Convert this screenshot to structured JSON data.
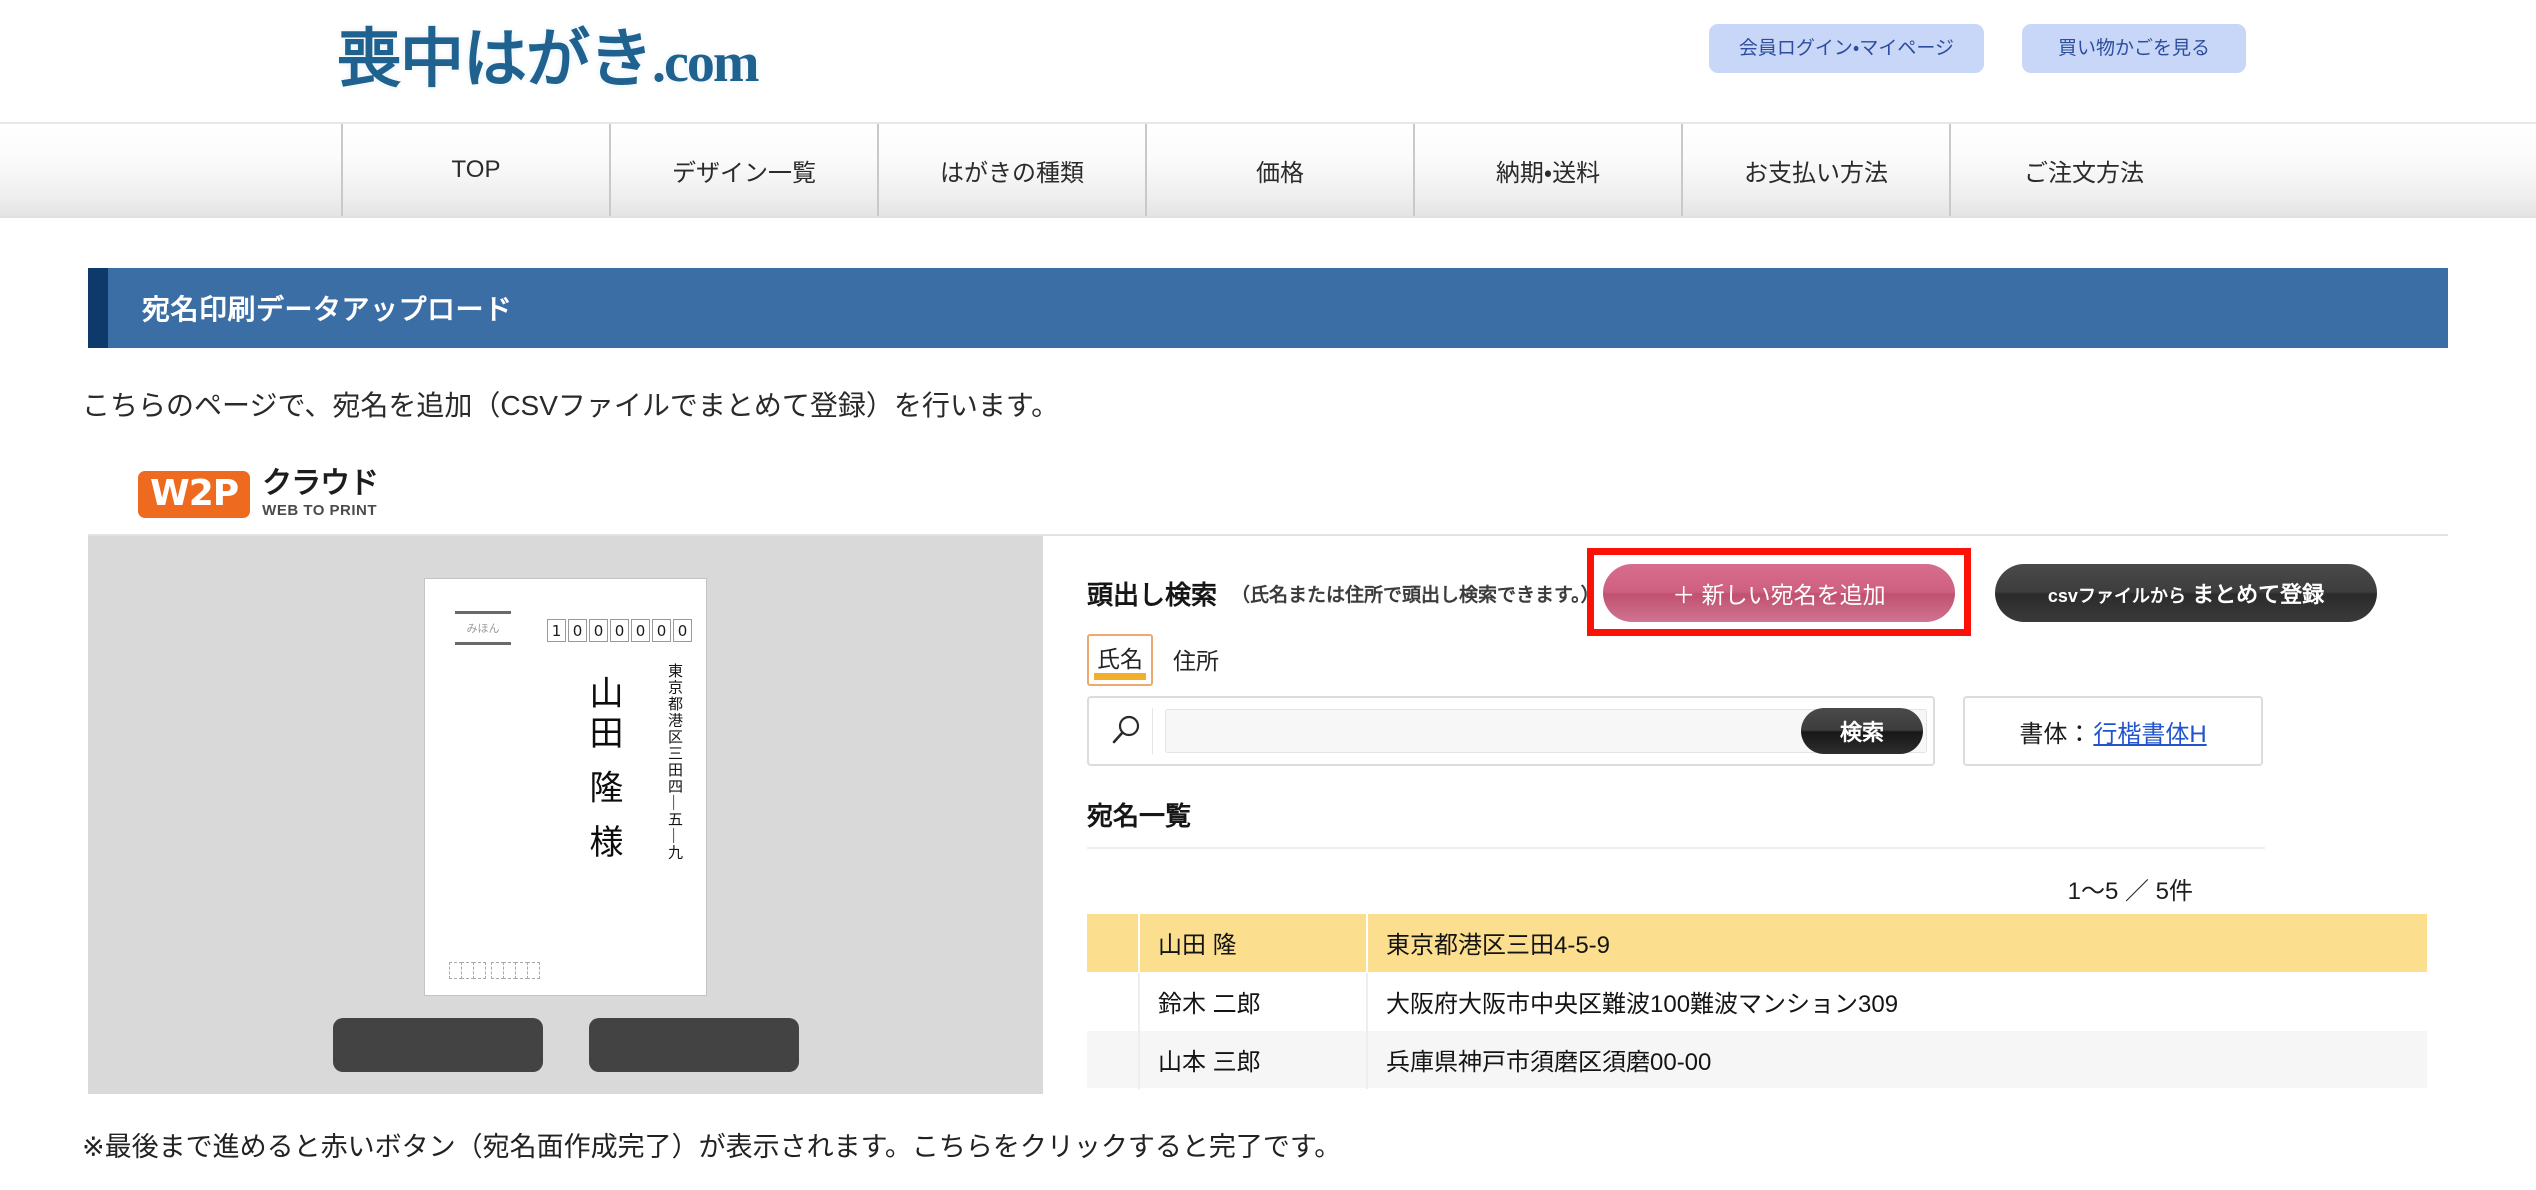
{
  "header": {
    "logo_text": "喪中はがき",
    "logo_suffix": ".com",
    "login_button": "会員ログイン・マイページ",
    "cart_button": "買い物かごを見る"
  },
  "nav": {
    "items": [
      {
        "label": "TOP"
      },
      {
        "label": "デザイン一覧"
      },
      {
        "label": "はがきの種類"
      },
      {
        "label": "価格"
      },
      {
        "label": "納期・送料"
      },
      {
        "label": "お支払い方法"
      },
      {
        "label": "ご注文方法"
      }
    ]
  },
  "page": {
    "section_title": "宛名印刷データアップロード",
    "lead_text": "こちらのページで、宛名を追加（CSVファイルでまとめて登録）を行います。",
    "footer_note": "※最後まで進めると赤いボタン（宛名面作成完了）が表示されます。こちらをクリックすると完了です。"
  },
  "w2p": {
    "badge": "W2P",
    "kana": "クラウド",
    "subtitle": "WEB TO PRINT"
  },
  "preview": {
    "mihon_label": "みほん",
    "zip_digits": [
      "1",
      "0",
      "0",
      "0",
      "0",
      "0",
      "0"
    ],
    "address_vertical": "東京都港区三田四—五—九",
    "name_vertical": "山田 隆 様"
  },
  "search": {
    "title": "頭出し検索",
    "hint": "（氏名または住所で頭出し検索できます。）",
    "add_button": "＋ 新しい宛名を追加",
    "csv_button_small": "csvファイルから",
    "csv_button_main": "まとめて登録",
    "tabs": [
      {
        "label": "氏名",
        "active": true
      },
      {
        "label": "住所",
        "active": false
      }
    ],
    "input_value": "",
    "input_placeholder": "",
    "search_button": "検索",
    "font_label": "書体：",
    "font_value": "行楷書体H"
  },
  "list": {
    "title": "宛名一覧",
    "count_text": "1〜5 ／ 5件",
    "rows": [
      {
        "name": "山田 隆",
        "address": "東京都港区三田4-5-9",
        "selected": true
      },
      {
        "name": "鈴木 二郎",
        "address": "大阪府大阪市中央区難波100難波マンション309",
        "selected": false
      },
      {
        "name": "山本 三郎",
        "address": "兵庫県神戸市須磨区須磨00-00",
        "selected": false
      }
    ]
  },
  "colors": {
    "brand_blue": "#1f628f",
    "section_blue": "#3b6ea5",
    "section_accent": "#0e3a6b",
    "highlight_red": "#fb1107",
    "add_pink": "#cf5f81",
    "orange": "#ee6a1e",
    "row_selected": "#fbdf8f",
    "link_blue": "#2255cc",
    "tab_underline": "#f3ae2c"
  }
}
